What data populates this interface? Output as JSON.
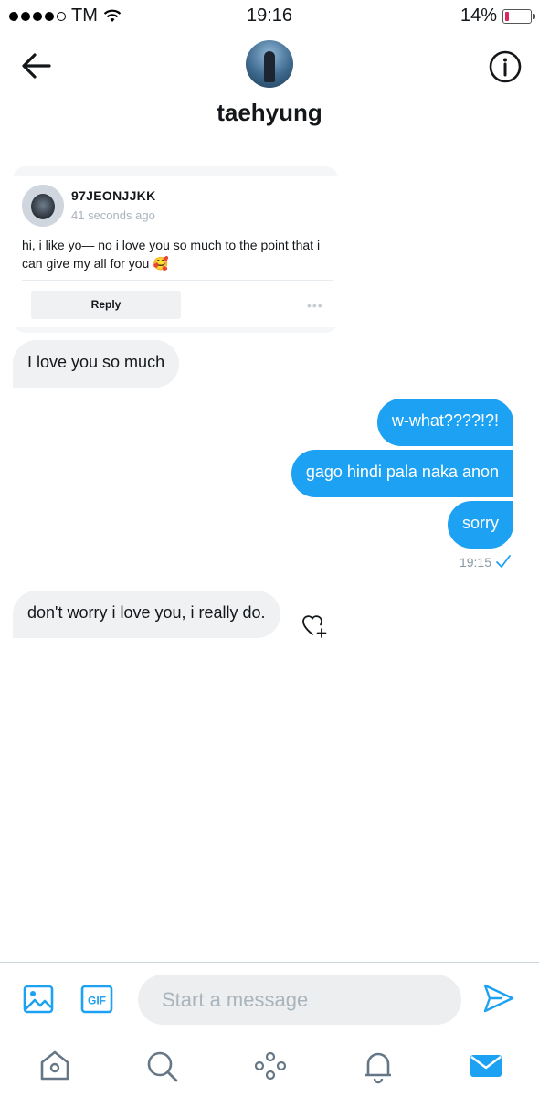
{
  "status_bar": {
    "carrier": "TM",
    "time": "19:16",
    "battery": "14%",
    "battery_level": 0.14,
    "signal_bars": 4
  },
  "header": {
    "title": "taehyung",
    "back_icon": "arrow-left-icon",
    "info_icon": "info-icon"
  },
  "shared_card": {
    "username": "97JEONJJKK",
    "time": "41 seconds ago",
    "text": "hi, i like yo— no i love you so much to the point that i can give my all for you 🥰",
    "reply_label": "Reply",
    "more_label": "•••"
  },
  "messages": [
    {
      "direction": "incoming",
      "text": "I love you so much"
    },
    {
      "direction": "outgoing",
      "text": "w-what????!?!"
    },
    {
      "direction": "outgoing",
      "text": "gago hindi pala naka anon"
    },
    {
      "direction": "outgoing",
      "text": "sorry"
    },
    {
      "direction": "incoming",
      "text": "don't worry i love you, i really do."
    }
  ],
  "sent_meta": {
    "time": "19:15",
    "status_icon": "checkmark-icon"
  },
  "composer": {
    "placeholder": "Start a message",
    "gif_label": "GIF"
  },
  "nav": {
    "items": [
      "home-icon",
      "search-icon",
      "spaces-icon",
      "notifications-icon",
      "messages-icon"
    ],
    "active": "messages-icon"
  },
  "colors": {
    "accent": "#1da1f2",
    "incoming_bubble": "#f0f1f3",
    "battery_low": "#e0245e"
  }
}
